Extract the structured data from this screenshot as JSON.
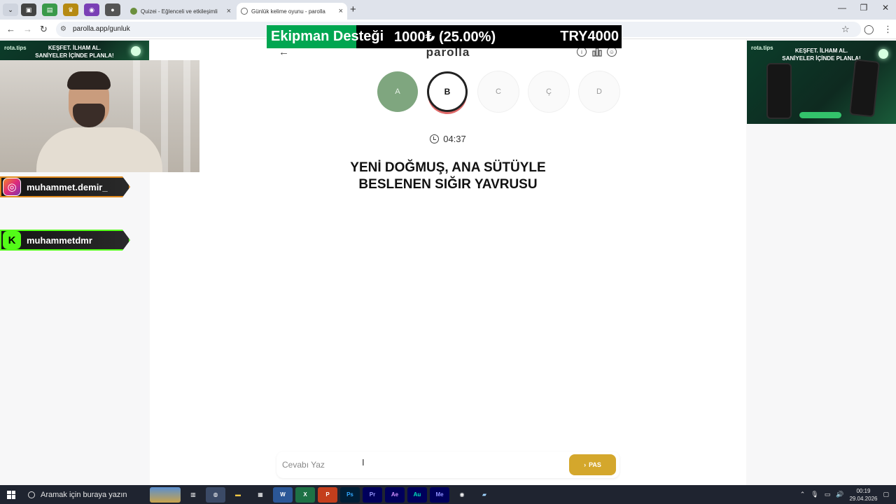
{
  "browser": {
    "tabs": [
      {
        "title": "Quizei - Eğlenceli ve etkileşimli",
        "active": false
      },
      {
        "title": "Günlük kelime oyunu - parolla",
        "active": true
      }
    ],
    "url": "parolla.app/gunluk",
    "new_tab": "+",
    "controls": {
      "minimize": "—",
      "restore": "❐",
      "close": "✕"
    }
  },
  "ticker": {
    "label": "Ekipman Desteği",
    "amount": "1000₺ (25.00%)",
    "goal": "TRY4000",
    "progress_fraction": 0.25
  },
  "overlay": {
    "ad": {
      "brand": "rota.tips",
      "line1": "KEŞFET. İLHAM AL.",
      "line2": "SANİYELER İÇİNDE PLANLA!"
    },
    "instagram": "muhammet.demir_",
    "kick": "muhammetdmr"
  },
  "game": {
    "logo": "parolla",
    "letters": [
      {
        "letter": "A",
        "state": "done"
      },
      {
        "letter": "B",
        "state": "current"
      },
      {
        "letter": "C",
        "state": "pending"
      },
      {
        "letter": "Ç",
        "state": "pending"
      },
      {
        "letter": "D",
        "state": "pending"
      }
    ],
    "timer": "04:37",
    "question_line1": "YENİ DOĞMUŞ, ANA SÜTÜYLE",
    "question_line2": "BESLENEN SIĞIR YAVRUSU",
    "answer_placeholder": "Cevabı Yaz",
    "pass_label": "PAS"
  },
  "taskbar": {
    "search_placeholder": "Aramak için buraya yazın",
    "time": "00:19",
    "date": "29.04.2026",
    "apps": [
      "Ps",
      "Pr",
      "Ae",
      "Au",
      "Me"
    ]
  },
  "colors": {
    "done": "#7fa67f",
    "pass_button": "#d4a72c",
    "ticker_green": "#00a651",
    "current_ring_accent": "#e06a6a"
  }
}
